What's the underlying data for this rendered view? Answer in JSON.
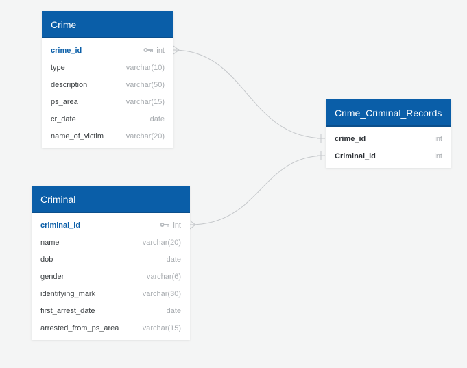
{
  "tables": {
    "crime": {
      "title": "Crime",
      "columns": [
        {
          "name": "crime_id",
          "type": "int",
          "pk": true
        },
        {
          "name": "type",
          "type": "varchar(10)"
        },
        {
          "name": "description",
          "type": "varchar(50)"
        },
        {
          "name": "ps_area",
          "type": "varchar(15)"
        },
        {
          "name": "cr_date",
          "type": "date"
        },
        {
          "name": "name_of_victim",
          "type": "varchar(20)"
        }
      ]
    },
    "records": {
      "title": "Crime_Criminal_Records",
      "columns": [
        {
          "name": "crime_id",
          "type": "int"
        },
        {
          "name": "Criminal_id",
          "type": "int"
        }
      ]
    },
    "criminal": {
      "title": "Criminal",
      "columns": [
        {
          "name": "criminal_id",
          "type": "int",
          "pk": true
        },
        {
          "name": "name",
          "type": "varchar(20)"
        },
        {
          "name": "dob",
          "type": "date"
        },
        {
          "name": "gender",
          "type": "varchar(6)"
        },
        {
          "name": "identifying_mark",
          "type": "varchar(30)"
        },
        {
          "name": "first_arrest_date",
          "type": "date"
        },
        {
          "name": "arrested_from_ps_area",
          "type": "varchar(15)"
        }
      ]
    }
  },
  "icons": {
    "primary_key": "key-icon"
  },
  "colors": {
    "header": "#0a5ea8",
    "pk_text": "#0a5ea8",
    "type_text": "#a9adb1",
    "connector": "#c4c7ca",
    "background": "#f4f5f5"
  }
}
